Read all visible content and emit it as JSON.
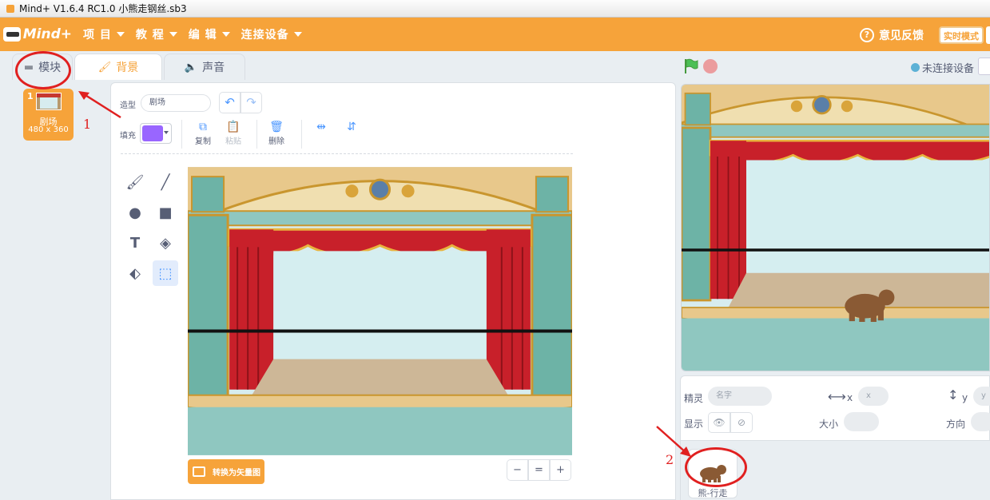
{
  "titlebar": {
    "title": "Mind+ V1.6.4 RC1.0   小熊走钢丝.sb3"
  },
  "menubar": {
    "logo_text": "Mind+",
    "items": [
      {
        "label": "项 目"
      },
      {
        "label": "教 程"
      },
      {
        "label": "编 辑"
      },
      {
        "label": "连接设备"
      }
    ],
    "feedback": "意见反馈",
    "mode_button": "实时模式"
  },
  "tabs": [
    {
      "label": "模块",
      "icon": "blocks-icon",
      "active": false
    },
    {
      "label": "背景",
      "icon": "brush-icon",
      "active": true
    },
    {
      "label": "声音",
      "icon": "speaker-icon",
      "active": false
    }
  ],
  "costumes": [
    {
      "index": "1",
      "name": "剧场",
      "size": "480 x 360",
      "selected": true
    }
  ],
  "editor": {
    "costume_label": "造型",
    "costume_name": "剧场",
    "fill_label": "填充",
    "fill_color": "#9966ff",
    "actions": [
      {
        "label": "复制",
        "icon": "copy-icon",
        "enabled": true
      },
      {
        "label": "粘贴",
        "icon": "paste-icon",
        "enabled": false
      },
      {
        "label": "删除",
        "icon": "trash-icon",
        "enabled": true
      }
    ],
    "tools": [
      {
        "name": "brush-tool",
        "glyph": "🖌"
      },
      {
        "name": "line-tool",
        "glyph": "╱"
      },
      {
        "name": "circle-tool",
        "glyph": "●"
      },
      {
        "name": "rectangle-tool",
        "glyph": "■"
      },
      {
        "name": "text-tool",
        "glyph": "T"
      },
      {
        "name": "fill-tool",
        "glyph": "◈"
      },
      {
        "name": "eraser-tool",
        "glyph": "⬖"
      },
      {
        "name": "select-tool",
        "glyph": "⬚"
      }
    ],
    "convert_button": "转换为矢量图",
    "zoom": {
      "out": "−",
      "reset": "=",
      "in": "+"
    }
  },
  "stage_controls": {
    "connection": "未连接设备"
  },
  "sprite_info": {
    "sprite_label": "精灵",
    "name_placeholder": "名字",
    "x_label": "x",
    "x_placeholder": "x",
    "y_label": "y",
    "y_placeholder": "y",
    "show_label": "显示",
    "size_label": "大小",
    "direction_label": "方向"
  },
  "sprites": [
    {
      "name": "熊-行走"
    }
  ],
  "annotations": [
    {
      "number": "1",
      "color": "#e02020"
    },
    {
      "number": "2",
      "color": "#e02020"
    }
  ],
  "colors": {
    "accent": "#f6a33a",
    "blue": "#4c97ff",
    "annotation_red": "#e02020"
  }
}
